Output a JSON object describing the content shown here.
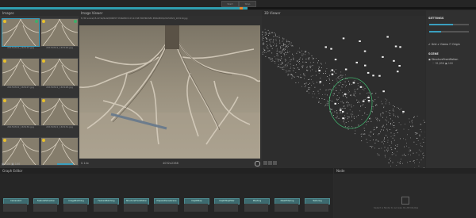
{
  "topbar": {
    "btn1": "Start",
    "btn2": "Stop"
  },
  "progress": {
    "fraction": 0.52
  },
  "images_panel": {
    "title": "Images",
    "thumbs": [
      {
        "label": "20150322_163110.jpg"
      },
      {
        "label": "20150322_163126.jpg"
      },
      {
        "label": "20150322_163127.jpg"
      },
      {
        "label": "20150322_163128.jpg"
      },
      {
        "label": "20150322_163130.jpg"
      },
      {
        "label": "20150322_163131.jpg"
      },
      {
        "label": ""
      },
      {
        "label": ""
      }
    ],
    "footer_count1": "100",
    "footer_count2": "100"
  },
  "image_viewer": {
    "title": "Image Viewer",
    "path": "E:/3D scans/15-22 Sb/SLAM/DIRECT PORAMICS 03-22 SB EXCERCISES PORAMICS/20150322_163110.jpg",
    "zoom": "0.14x",
    "resolution": "4032x2268"
  },
  "viewer3d": {
    "title": "3D Viewer"
  },
  "settings": {
    "title": "SETTINGS",
    "slider1": 0.6,
    "slider2": 0.3,
    "grid_label": "Grid",
    "gizmo_label": "Gizmo",
    "origin_label": "Origin",
    "scene_title": "SCENE",
    "scene_item": "StructureFromMotion",
    "scene_count1": "91,856",
    "scene_count2": "100"
  },
  "graph_editor": {
    "title": "Graph Editor",
    "nodes": [
      {
        "label": "CameraInit"
      },
      {
        "label": "FeatureExtraction"
      },
      {
        "label": "ImageMatching"
      },
      {
        "label": "FeatureMatching"
      },
      {
        "label": "StructureFromMotion"
      },
      {
        "label": "PrepareDenseScene"
      },
      {
        "label": "DepthMap"
      },
      {
        "label": "DepthMapFilter"
      },
      {
        "label": "Meshing"
      },
      {
        "label": "MeshFiltering"
      },
      {
        "label": "Texturing"
      }
    ]
  },
  "node_panel": {
    "title": "Node",
    "hint": "Select a Node to access its Attributes"
  }
}
